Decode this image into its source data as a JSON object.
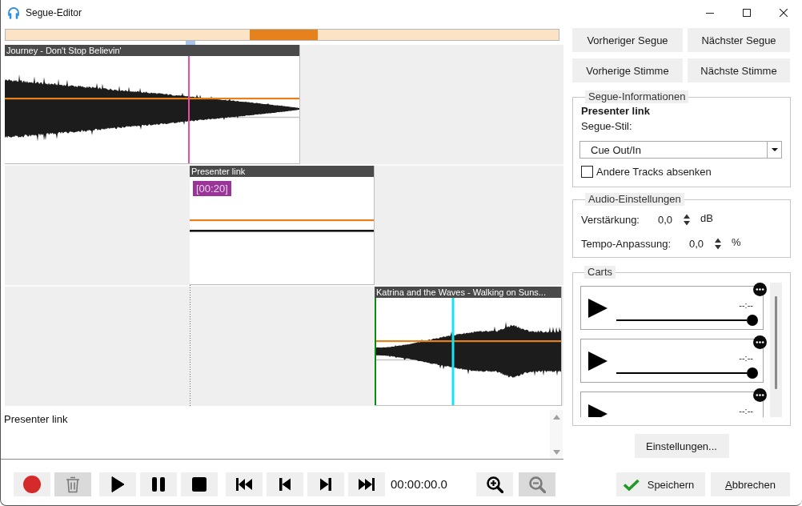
{
  "window": {
    "title": "Segue-Editor"
  },
  "tracks": [
    {
      "kind": "audio",
      "title": "Journey - Don't Stop Believin'"
    },
    {
      "kind": "voice",
      "title": "Presenter link",
      "badge": "[00:20]"
    },
    {
      "kind": "audio",
      "title": "Katrina and the Waves - Walking on Suns..."
    }
  ],
  "notes": {
    "value": "Presenter link"
  },
  "transport": {
    "edit": [
      {
        "kind": "record",
        "disabled": false
      },
      {
        "kind": "delete",
        "disabled": true
      }
    ],
    "playback": [
      {
        "kind": "play",
        "disabled": false
      },
      {
        "kind": "pause",
        "disabled": false
      },
      {
        "kind": "stop",
        "disabled": false
      }
    ],
    "navigation": [
      {
        "kind": "first",
        "disabled": false
      },
      {
        "kind": "previous",
        "disabled": false
      },
      {
        "kind": "next",
        "disabled": false
      },
      {
        "kind": "last",
        "disabled": false
      }
    ],
    "time": "00:00:00.0",
    "zoom": [
      {
        "kind": "zoom_in",
        "disabled": false
      },
      {
        "kind": "zoom_out",
        "disabled": true
      }
    ]
  },
  "navigation": [
    "Vorheriger Segue",
    "Nächster Segue",
    "Vorherige Stimme",
    "Nächste Stimme"
  ],
  "segue_info": {
    "legend": "Segue-Informationen",
    "name": "Presenter link",
    "style_label": "Segue-Stil:",
    "style_value": "Cue Out/In",
    "duck_others": {
      "label": "Andere Tracks absenken",
      "checked": false
    }
  },
  "audio_settings": {
    "legend": "Audio-Einstellungen",
    "rows": [
      {
        "label": "Verstärkung:",
        "value": "0,0",
        "unit": "dB"
      },
      {
        "label": "Tempo-Anpassung:",
        "value": "0,0",
        "unit": "%"
      }
    ]
  },
  "carts": {
    "legend": "Carts",
    "items": [
      {
        "time": "--:--",
        "level": 1
      },
      {
        "time": "--:--",
        "level": 1
      },
      {
        "time": "--:--"
      }
    ]
  },
  "settings_button": "Einstellungen...",
  "dialog_buttons": [
    {
      "kind": "save",
      "label": "Speichern"
    },
    {
      "kind": "cancel",
      "label": "Abbrechen"
    }
  ]
}
